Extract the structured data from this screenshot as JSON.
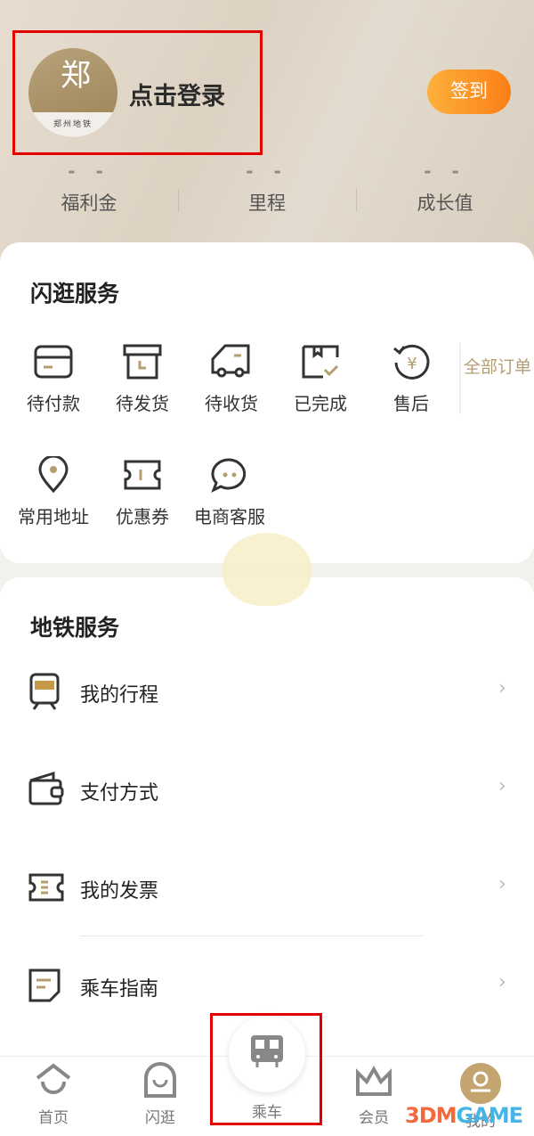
{
  "header": {
    "logo_text": "郑州地铁",
    "login_label": "点击登录",
    "sign_in_label": "签到",
    "stats": [
      {
        "value": "- -",
        "label": "福利金"
      },
      {
        "value": "- -",
        "label": "里程"
      },
      {
        "value": "- -",
        "label": "成长值"
      }
    ]
  },
  "shop_services": {
    "title": "闪逛服务",
    "orders": [
      {
        "label": "待付款",
        "icon": "card-icon"
      },
      {
        "label": "待发货",
        "icon": "box-icon"
      },
      {
        "label": "待收货",
        "icon": "truck-icon"
      },
      {
        "label": "已完成",
        "icon": "package-check-icon"
      },
      {
        "label": "售后",
        "icon": "refund-icon"
      }
    ],
    "all_orders": "全部订单",
    "others": [
      {
        "label": "常用地址",
        "icon": "location-icon"
      },
      {
        "label": "优惠券",
        "icon": "coupon-icon"
      },
      {
        "label": "电商客服",
        "icon": "chat-icon"
      }
    ]
  },
  "metro_services": {
    "title": "地铁服务",
    "items": [
      {
        "label": "我的行程",
        "icon": "train-icon"
      },
      {
        "label": "支付方式",
        "icon": "wallet-icon"
      },
      {
        "label": "我的发票",
        "icon": "invoice-icon"
      },
      {
        "label": "乘车指南",
        "icon": "guide-icon"
      }
    ]
  },
  "bottom_nav": [
    {
      "label": "首页",
      "icon": "home-icon"
    },
    {
      "label": "闪逛",
      "icon": "bag-icon"
    },
    {
      "label": "乘车",
      "icon": "bus-icon",
      "active": true
    },
    {
      "label": "会员",
      "icon": "crown-icon"
    },
    {
      "label": "我的",
      "icon": "user-icon"
    }
  ],
  "watermark": "3DMGAME",
  "colors": {
    "accent_gold": "#b59d72",
    "sign_orange": "#fb7f16",
    "highlight_red": "#e00000"
  }
}
